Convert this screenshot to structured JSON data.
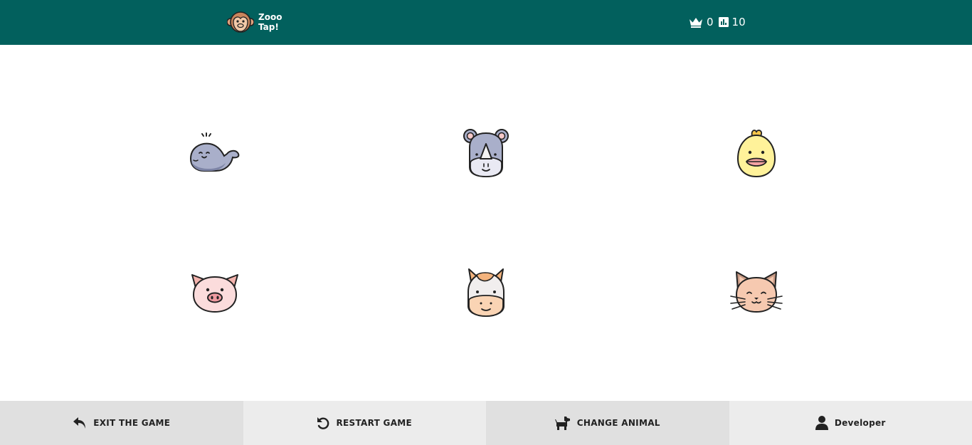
{
  "app": {
    "title_line1": "Zooo",
    "title_line2": "Tap!",
    "logo_icon": "monkey-icon"
  },
  "stats": {
    "score_icon": "crown-icon",
    "score": "0",
    "target_icon": "bar-chart-icon",
    "target": "10"
  },
  "animals": [
    {
      "name": "whale"
    },
    {
      "name": "rhino"
    },
    {
      "name": "chick"
    },
    {
      "name": "pig"
    },
    {
      "name": "horse"
    },
    {
      "name": "cat"
    }
  ],
  "footer": {
    "exit_label": "EXIT THE GAME",
    "exit_icon": "reply-arrow-icon",
    "restart_label": "RESTART GAME",
    "restart_icon": "restart-icon",
    "change_label": "CHANGE ANIMAL",
    "change_icon": "dog-icon",
    "developer_label": "Developer",
    "developer_icon": "user-icon"
  },
  "colors": {
    "header_bg": "#02605d",
    "footer_dark": "#e0e0e0",
    "footer_light": "#ececec",
    "text_dark": "#222222"
  }
}
